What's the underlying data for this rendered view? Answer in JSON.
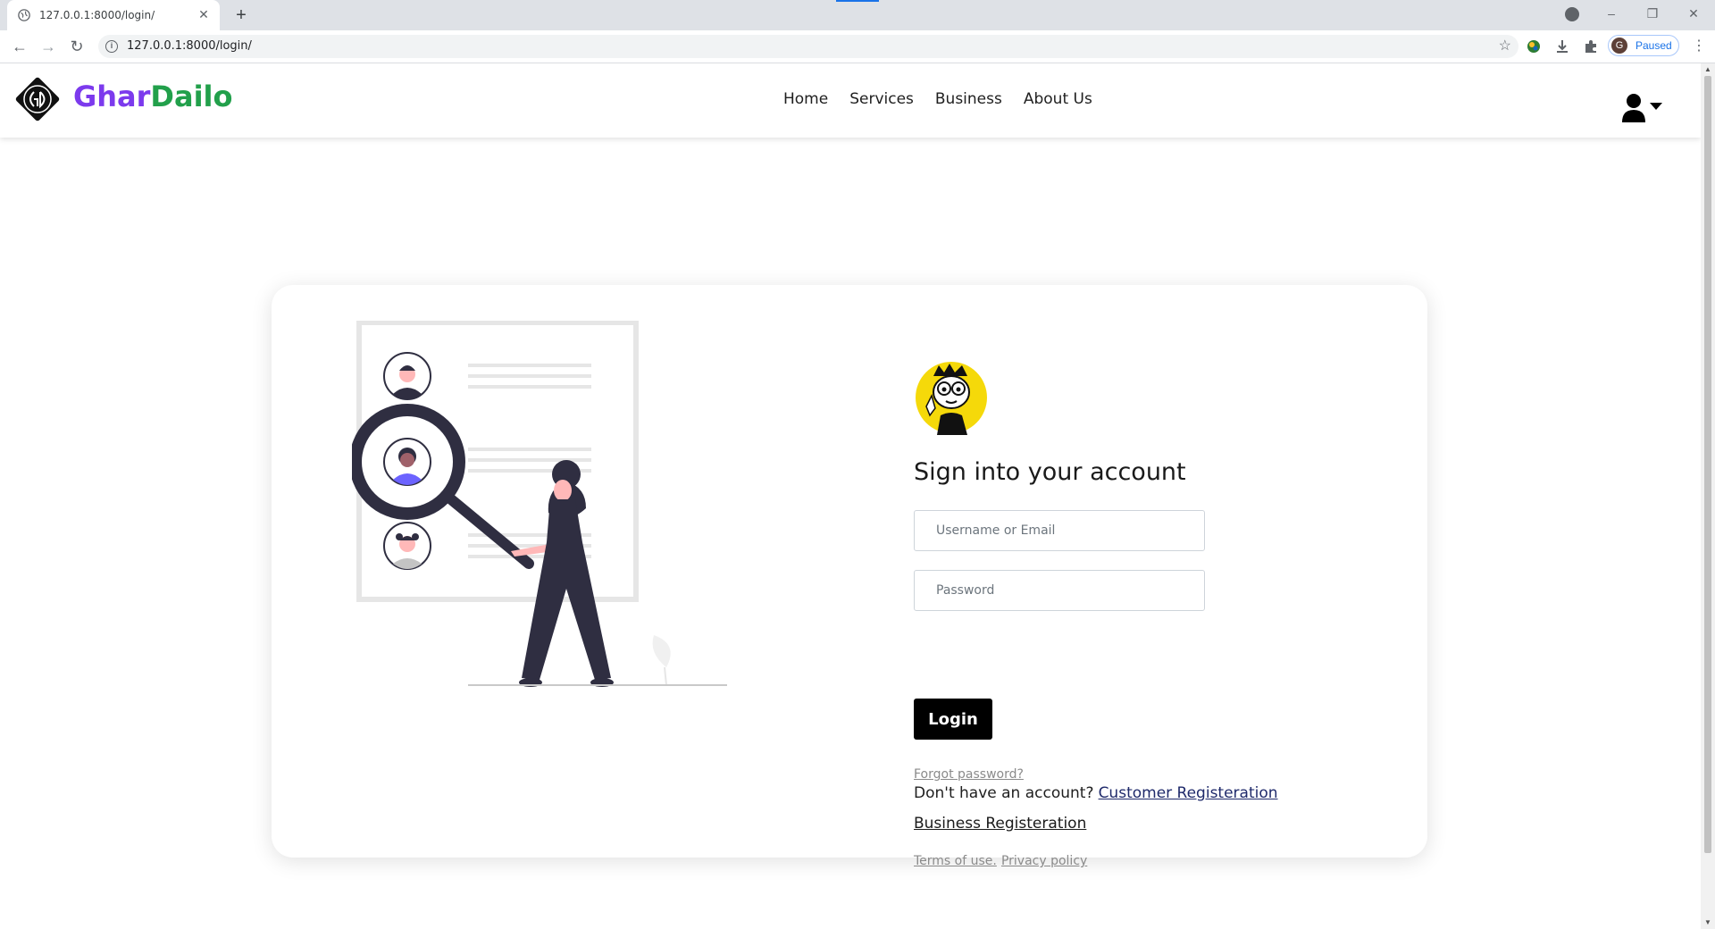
{
  "browser": {
    "tab_title": "127.0.0.1:8000/login/",
    "tab_close": "✕",
    "new_tab": "+",
    "url": "127.0.0.1:8000/login/",
    "profile_initial": "G",
    "profile_status": "Paused",
    "window_controls": {
      "minimize": "–",
      "restore": "❐",
      "close": "✕"
    }
  },
  "site": {
    "brand_part1": "Ghar",
    "brand_part2": "Dailo",
    "nav": [
      {
        "label": "Home"
      },
      {
        "label": "Services"
      },
      {
        "label": "Business"
      },
      {
        "label": "About Us"
      }
    ]
  },
  "login": {
    "title": "Sign into your account",
    "username_placeholder": "Username or Email",
    "password_placeholder": "Password",
    "login_button": "Login",
    "forgot_password": "Forgot password?",
    "no_account_text": "Don't have an account?",
    "customer_registration": "Customer Registeration",
    "business_registration": "Business Registeration",
    "terms": "Terms of use.",
    "privacy": "Privacy policy"
  },
  "colors": {
    "brand_purple": "#7c3aed",
    "brand_green": "#22a04b",
    "button_black": "#000000",
    "mascot_yellow": "#f5d90a",
    "illustration_dark": "#2f2e41",
    "illustration_skin": "#ffb8b8",
    "illustration_accent": "#6c63ff"
  },
  "icons": {
    "favicon": "globe-icon",
    "info": "info-icon",
    "bookmark": "star-icon",
    "user_menu": "user-icon",
    "dropdown": "caret-down-icon"
  }
}
